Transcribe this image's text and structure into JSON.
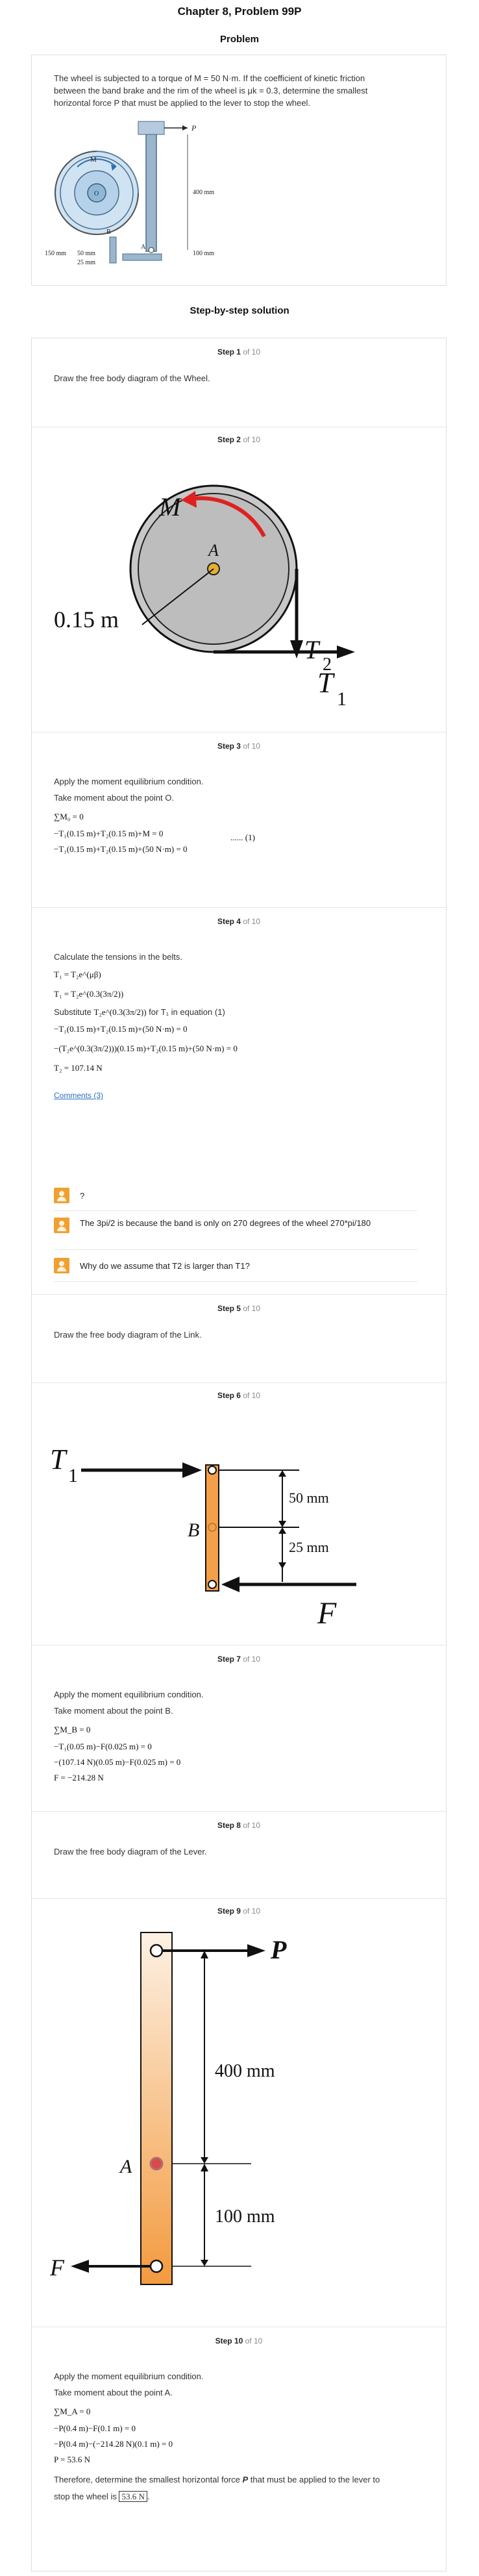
{
  "header": {
    "chapter_title": "Chapter 8, Problem 99P",
    "problem_heading": "Problem"
  },
  "problem": {
    "text_lines": [
      "The wheel is subjected to a torque of M = 50 N·m. If the coefficient of kinetic friction",
      "between the band brake and the rim of the wheel is μk = 0.3, determine the smallest",
      "horizontal force P that must be applied to the lever to stop the wheel."
    ],
    "figure_labels": {
      "m": "M",
      "p": "P",
      "d400": "400 mm",
      "d150": "150 mm",
      "d50": "50 mm",
      "d25": "25 mm",
      "d100": "100 mm",
      "b": "B",
      "a": "A",
      "o": "O"
    }
  },
  "solution_heading": "Step-by-step solution",
  "step_total_label": "of 10",
  "steps": [
    {
      "label": "Step 1",
      "text": "Draw the free body diagram of the Wheel."
    },
    {
      "label": "Step 2",
      "fig": {
        "m": "M",
        "a": "A",
        "r": "0.15 m",
        "t2": "T",
        "t2sub": "2",
        "t1": "T",
        "t1sub": "1"
      }
    },
    {
      "label": "Step 3",
      "text": "Apply the moment equilibrium condition.",
      "text2": "Take moment about the point O.",
      "eq1": "∑M₀ = 0",
      "eq2": "−T₁(0.15 m)+T₂(0.15 m)+M = 0",
      "eq3": "−T₁(0.15 m)+T₂(0.15 m)+(50 N·m) = 0",
      "eq_ref": "...... (1)"
    },
    {
      "label": "Step 4",
      "text": "Calculate the tensions in the belts.",
      "eq1": "T₁ = T₂e^(μβ)",
      "eq2": "T₁ = T₂e^(0.3(3π/2))",
      "subst_a": "Substitute",
      "subst_b": "T₂e^(0.3(3π/2))",
      "subst_c": "for T₁ in equation (1)",
      "eq3": "−T₁(0.15 m)+T₂(0.15 m)+(50 N·m) = 0",
      "eq4": "−(T₂e^(0.3(3π/2)))(0.15 m)+T₂(0.15 m)+(50 N·m) = 0",
      "eq5": "T₂ = 107.14 N",
      "comments_label": "Comments (3)",
      "comments": [
        {
          "text": "?"
        },
        {
          "text": "The 3pi/2 is because the band is only on 270 degrees of the wheel 270*pi/180"
        },
        {
          "text": "Why do we assume that T2 is larger than T1?"
        }
      ]
    },
    {
      "label": "Step 5",
      "text": "Draw the free body diagram of the Link."
    },
    {
      "label": "Step 6",
      "fig": {
        "t1": "T",
        "t1sub": "1",
        "b": "B",
        "d50": "50 mm",
        "d25": "25 mm",
        "f": "F"
      }
    },
    {
      "label": "Step 7",
      "text": "Apply the moment equilibrium condition.",
      "text2": "Take moment about the point B.",
      "eq1": "∑M_B = 0",
      "eq2": "−T₁(0.05 m)−F(0.025 m) = 0",
      "eq3": "−(107.14 N)(0.05 m)−F(0.025 m) = 0",
      "eq4": "F = −214.28 N"
    },
    {
      "label": "Step 8",
      "text": "Draw the free body diagram of the Lever."
    },
    {
      "label": "Step 9",
      "fig": {
        "p": "P",
        "d400": "400 mm",
        "a": "A",
        "d100": "100 mm",
        "f": "F"
      }
    },
    {
      "label": "Step 10",
      "text": "Apply the moment equilibrium condition.",
      "text2": "Take moment about the point A.",
      "eq1": "∑M_A = 0",
      "eq2": "−P(0.4 m)−F(0.1 m) = 0",
      "eq3": "−P(0.4 m)−(−214.28 N)(0.1 m) = 0",
      "eq4": "P = 53.6 N",
      "final_a": "Therefore, determine the smallest horizontal force",
      "final_p": "P",
      "final_b": "that must be applied to the lever to",
      "final_c": "stop the wheel is",
      "final_value": "53.6 N",
      "final_d": "."
    }
  ],
  "colors": {
    "accent_link": "#2a6ebb",
    "border": "#dedede",
    "lever_orange": "#f4a04a",
    "arrow_red": "#e02020",
    "wheel_blue": "#cfe3f3"
  }
}
